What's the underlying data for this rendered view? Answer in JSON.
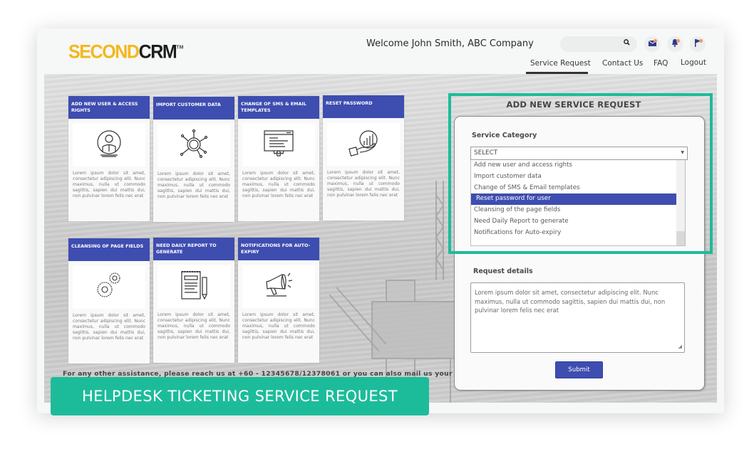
{
  "header": {
    "logo_part1": "SECOND",
    "logo_part2": "CRM",
    "logo_tm": "TM",
    "welcome": "Welcome John Smith, ABC Company",
    "search_placeholder": "",
    "icons": [
      "search-icon",
      "mail-icon",
      "bell-icon",
      "flag-icon"
    ],
    "nav": [
      {
        "label": "Service Request",
        "active": true
      },
      {
        "label": "Contact Us",
        "active": false
      },
      {
        "label": "FAQ",
        "active": false
      },
      {
        "label": "Logout",
        "active": false
      }
    ]
  },
  "tiles": [
    {
      "title": "ADD NEW USER & ACCESS RIGHTS",
      "icon": "user-icon",
      "text": "Lorem ipsum dolor sit amet, consectetur adipiscing elit. Nunc maximus, nulla ut commodo sagittis, sapien dui mattis dui, non pulvinar lorem felis nec erat"
    },
    {
      "title": "IMPORT CUSTOMER DATA",
      "icon": "network-hub-icon",
      "text": "Lorem ipsum dolor sit amet, consectetur adipiscing elit. Nunc maximus, nulla ut commodo sagittis, sapien dui mattis dui, non pulvinar lorem felis nec erat"
    },
    {
      "title": "CHANGE OF SMS & EMAIL TEMPLATES",
      "icon": "browser-settings-icon",
      "text": "Lorem ipsum dolor sit amet, consectetur adipiscing elit. Nunc maximus, nulla ut commodo sagittis, sapien dui mattis dui, non pulvinar lorem felis nec erat"
    },
    {
      "title": "RESET PASSWORD",
      "icon": "hand-chart-icon",
      "text": "Lorem ipsum dolor sit amet, consectetur adipiscing elit. Nunc maximus, nulla ut commodo sagittis, sapien dui mattis dui, non pulvinar lorem felis nec erat"
    },
    {
      "title": "CLEANSING OF PAGE FIELDS",
      "icon": "gears-icon",
      "text": "Lorem ipsum dolor sit amet, consectetur adipiscing elit. Nunc maximus, nulla ut commodo sagittis, sapien dui mattis dui, non pulvinar lorem felis nec erat"
    },
    {
      "title": "NEED DAILY REPORT TO GENERATE",
      "icon": "notepad-pencil-icon",
      "text": "Lorem ipsum dolor sit amet, consectetur adipiscing elit. Nunc maximus, nulla ut commodo sagittis, sapien dui mattis dui, non pulvinar lorem felis nec erat"
    },
    {
      "title": "NOTIFICATIONS FOR AUTO-EXPIRY",
      "icon": "megaphone-icon",
      "text": "Lorem ipsum dolor sit amet, consectetur adipiscing elit. Nunc maximus, nulla ut commodo sagittis, sapien dui mattis dui, non pulvinar lorem felis nec erat"
    }
  ],
  "form": {
    "title": "ADD NEW SERVICE REQUEST",
    "category_label": "Service Category",
    "select_value": "SELECT",
    "options": [
      "Add new user and access rights",
      "Import customer data",
      "Change of SMS & Email templates",
      "Reset password for user",
      "Cleansing of the page fields",
      "Need Daily Report to generate",
      "Notifications for Auto-expiry"
    ],
    "highlighted_option": "Reset password for user",
    "details_label": "Request details",
    "details_value": "Lorem ipsum dolor sit amet, consectetur adipiscing elit. Nunc maximus, nulla ut commodo sagittis, sapien dui mattis dui, non pulvinar lorem felis nec erat",
    "submit_label": "Submit"
  },
  "footer_note": "For any other assistance, please reach us at +60 - 12345678/12378061 or you can also mail us your",
  "banner": "HELPDESK TICKETING SERVICE REQUEST",
  "colors": {
    "brand_blue": "#3e4db0",
    "accent_teal": "#1cbc9b",
    "logo_yellow": "#f2b81c",
    "notification_dot": "#f5945c"
  }
}
